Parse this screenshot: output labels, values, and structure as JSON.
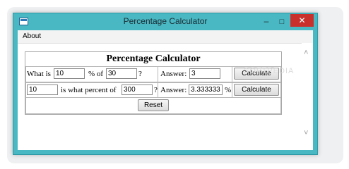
{
  "window": {
    "title": "Percentage Calculator",
    "min_symbol": "–",
    "max_symbol": "□",
    "close_symbol": "✕"
  },
  "menu": {
    "about": "About"
  },
  "calculator": {
    "heading": "Percentage Calculator",
    "row1": {
      "what_is_label": "What is",
      "value1": "10",
      "percent_of_label": "% of",
      "value2": "30",
      "question": "?",
      "answer_label": "Answer:",
      "answer": "3",
      "calculate_label": "Calculate"
    },
    "row2": {
      "value1": "10",
      "is_what_percent_label": "is what percent of",
      "value2": "300",
      "question": "?",
      "answer_label": "Answer:",
      "answer": "3.333333",
      "percent_sign": "%",
      "calculate_label": "Calculate"
    },
    "reset_label": "Reset"
  },
  "scroll": {
    "up": "˄",
    "down": "˅"
  },
  "watermark": "SOFTPEDIA"
}
